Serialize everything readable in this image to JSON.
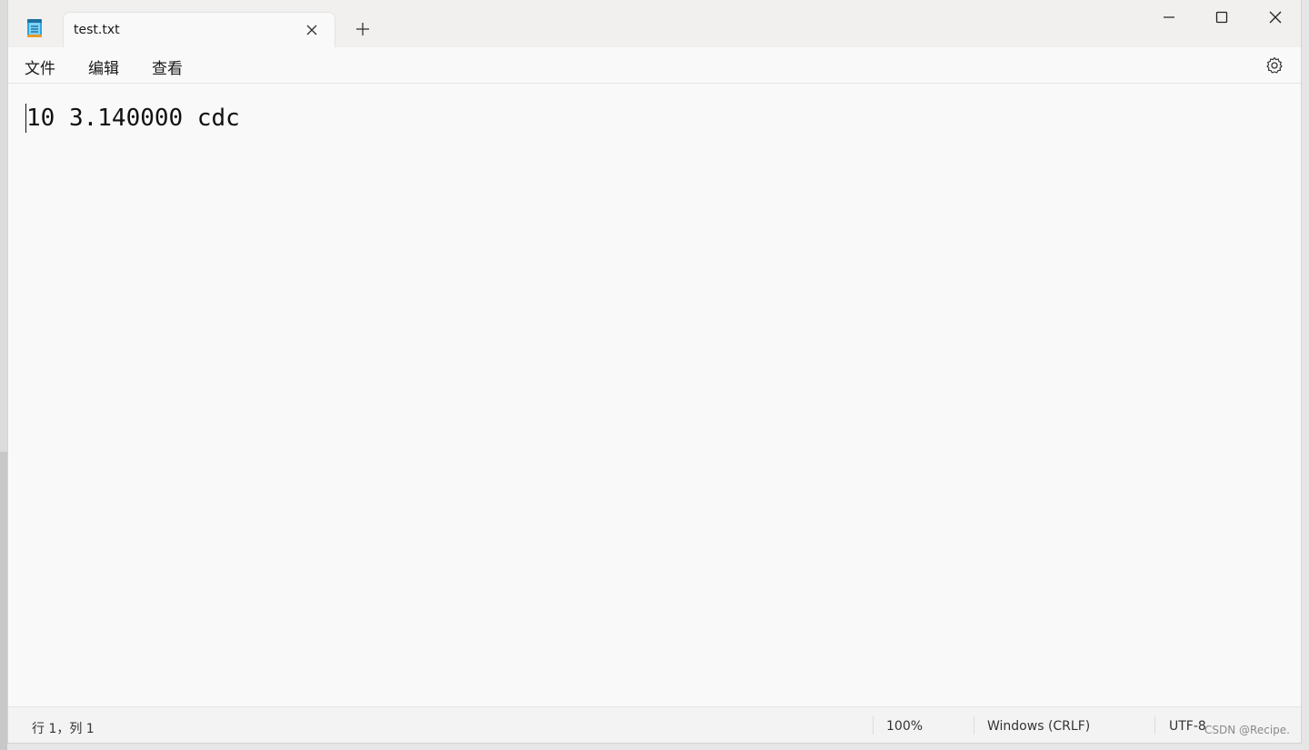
{
  "tab": {
    "title": "test.txt"
  },
  "menu": {
    "file": "文件",
    "edit": "编辑",
    "view": "查看"
  },
  "editor": {
    "content": "10 3.140000 cdc"
  },
  "status": {
    "position": "行 1，列 1",
    "zoom": "100%",
    "line_ending": "Windows (CRLF)",
    "encoding": "UTF-8"
  },
  "watermark": "CSDN @Recipe.",
  "icons": {
    "app": "notepad-icon",
    "close_tab": "close-icon",
    "new_tab": "plus-icon",
    "minimize": "minimize-icon",
    "maximize": "maximize-icon",
    "close_window": "close-icon",
    "settings": "gear-icon"
  },
  "colors": {
    "window_bg": "#f9f9f9",
    "titlebar_bg": "#f1f0ef",
    "statusbar_bg": "#f3f3f3",
    "app_icon_blue": "#2aa8e0"
  }
}
